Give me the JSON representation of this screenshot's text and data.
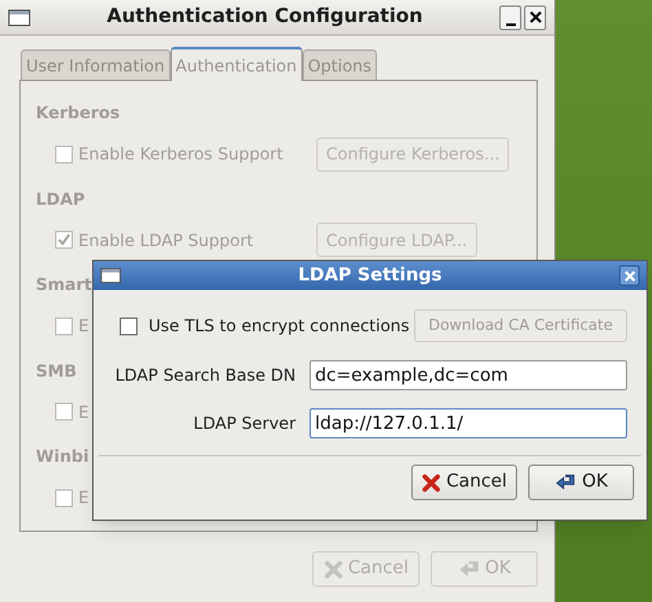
{
  "window": {
    "title": "Authentication Configuration",
    "disabled": true
  },
  "tabs": [
    {
      "label": "User Information",
      "selected": false
    },
    {
      "label": "Authentication",
      "selected": true
    },
    {
      "label": "Options",
      "selected": false
    }
  ],
  "sections": [
    {
      "title": "Kerberos",
      "option": {
        "label": "Enable Kerberos Support",
        "checked": false
      },
      "button": "Configure Kerberos..."
    },
    {
      "title": "LDAP",
      "option": {
        "label": "Enable LDAP Support",
        "checked": true
      },
      "button": "Configure LDAP..."
    },
    {
      "title": "Smart",
      "option": {
        "label": "E",
        "checked": false
      }
    },
    {
      "title": "SMB",
      "option": {
        "label": "E",
        "checked": false
      }
    },
    {
      "title": "Winbi",
      "option": {
        "label": "E",
        "checked": false
      }
    }
  ],
  "buttons": [
    {
      "label": "Cancel",
      "kind": "cancel"
    },
    {
      "label": "OK",
      "kind": "ok"
    }
  ],
  "ldap_dialog": {
    "title": "LDAP Settings",
    "tls": {
      "label": "Use TLS to encrypt connections",
      "checked": false
    },
    "download_button": {
      "label": "Download CA Certificate",
      "disabled": true
    },
    "fields": [
      {
        "label": "LDAP Search Base DN",
        "value": "dc=example,dc=com"
      },
      {
        "label": "LDAP Server",
        "value": "ldap://127.0.1.1/"
      }
    ],
    "buttons": [
      {
        "label": "Cancel",
        "kind": "cancel"
      },
      {
        "label": "OK",
        "kind": "ok"
      }
    ]
  }
}
